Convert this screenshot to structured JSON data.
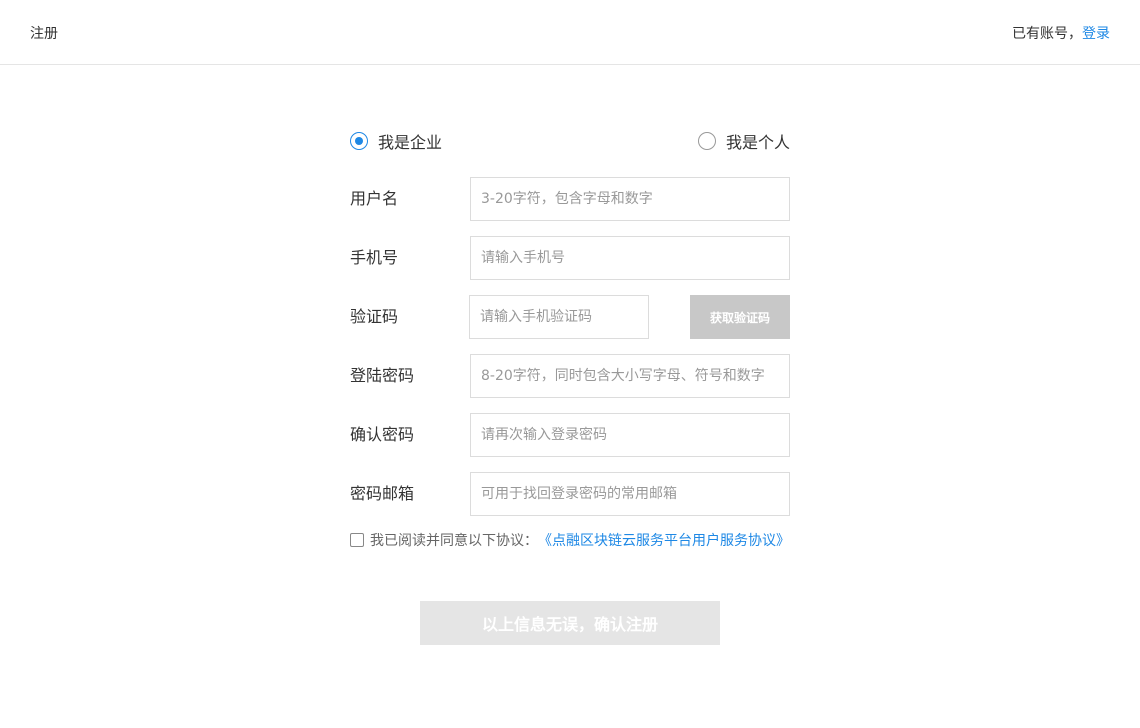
{
  "header": {
    "title": "注册",
    "login_prompt": "已有账号，",
    "login_link": "登录"
  },
  "account_type": {
    "options": [
      "我是企业",
      "我是个人"
    ],
    "selected": "我是企业"
  },
  "fields": {
    "username": {
      "label": "用户名",
      "placeholder": "3-20字符，包含字母和数字",
      "value": ""
    },
    "phone": {
      "label": "手机号",
      "placeholder": "请输入手机号",
      "value": ""
    },
    "code": {
      "label": "验证码",
      "placeholder": "请输入手机验证码",
      "value": "",
      "button": "获取验证码"
    },
    "password": {
      "label": "登陆密码",
      "placeholder": "8-20字符，同时包含大小写字母、符号和数字",
      "value": ""
    },
    "confirm": {
      "label": "确认密码",
      "placeholder": "请再次输入登录密码",
      "value": ""
    },
    "email": {
      "label": "密码邮箱",
      "placeholder": "可用于找回登录密码的常用邮箱",
      "value": ""
    }
  },
  "agreement": {
    "checked": false,
    "text": "我已阅读并同意以下协议：",
    "link": "《点融区块链云服务平台用户服务协议》"
  },
  "submit": {
    "label": "以上信息无误，确认注册"
  },
  "colors": {
    "accent": "#1e88e5",
    "button_disabled": "#c8c8c8",
    "submit_disabled": "#e5e5e5"
  },
  "icons": [
    "radio-checked-icon",
    "radio-unchecked-icon",
    "checkbox-icon"
  ]
}
